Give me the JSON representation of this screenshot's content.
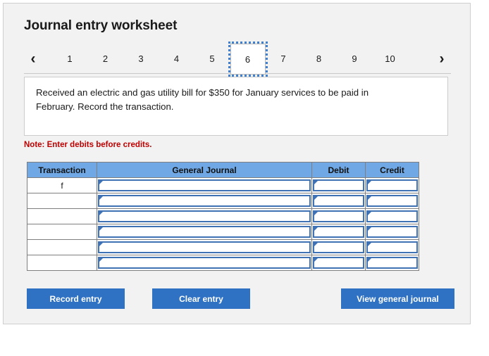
{
  "page_title": "Journal entry worksheet",
  "pager": {
    "prev_icon": "chevron-left-icon",
    "next_icon": "chevron-right-icon",
    "prev_glyph": "‹",
    "next_glyph": "›",
    "pages": [
      "1",
      "2",
      "3",
      "4",
      "5",
      "6",
      "7",
      "8",
      "9",
      "10"
    ],
    "active_page": "6"
  },
  "prompt": {
    "text": "Received an electric and gas utility bill for $350 for January services to be paid in February. Record the transaction."
  },
  "note": "Note: Enter debits before credits.",
  "table": {
    "headers": [
      "Transaction",
      "General Journal",
      "Debit",
      "Credit"
    ],
    "rows": [
      {
        "transaction": "f",
        "general_journal": "",
        "debit": "",
        "credit": ""
      },
      {
        "transaction": "",
        "general_journal": "",
        "debit": "",
        "credit": ""
      },
      {
        "transaction": "",
        "general_journal": "",
        "debit": "",
        "credit": ""
      },
      {
        "transaction": "",
        "general_journal": "",
        "debit": "",
        "credit": ""
      },
      {
        "transaction": "",
        "general_journal": "",
        "debit": "",
        "credit": ""
      },
      {
        "transaction": "",
        "general_journal": "",
        "debit": "",
        "credit": ""
      }
    ]
  },
  "buttons": {
    "record": "Record entry",
    "clear": "Clear entry",
    "view": "View general journal"
  },
  "colors": {
    "panel_bg": "#f2f2f2",
    "button_blue": "#2f72c4",
    "header_blue": "#6fa8e4",
    "input_border_blue": "#3f72b5",
    "note_red": "#c00000",
    "active_tab_outline": "#3f7fd0"
  }
}
